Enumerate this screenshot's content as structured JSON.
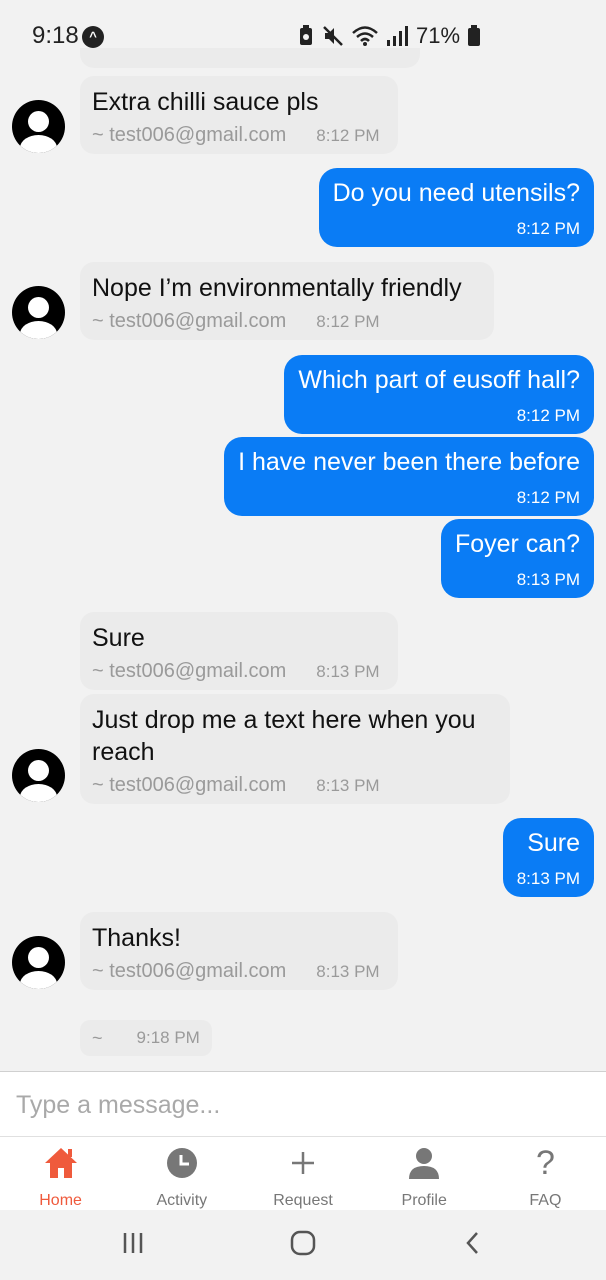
{
  "status_bar": {
    "time": "9:18",
    "battery": "71%"
  },
  "messages": [
    {
      "kind": "in",
      "text": "Extra chilli sauce pls",
      "sender": "~ test006@gmail.com",
      "time": "8:12 PM"
    },
    {
      "kind": "out",
      "text": "Do you need utensils?",
      "time": "8:12 PM"
    },
    {
      "kind": "in",
      "text": "Nope I’m environmentally friendly",
      "sender": "~ test006@gmail.com",
      "time": "8:12 PM"
    },
    {
      "kind": "out",
      "text": "Which part of eusoff hall?",
      "time": "8:12 PM"
    },
    {
      "kind": "out",
      "text": "I have never been there before",
      "time": "8:12 PM"
    },
    {
      "kind": "out",
      "text": "Foyer can?",
      "time": "8:13 PM"
    },
    {
      "kind": "in",
      "text": "Sure",
      "sender": "~ test006@gmail.com",
      "time": "8:13 PM"
    },
    {
      "kind": "in",
      "text": "Just drop me a text here when you reach",
      "sender": "~ test006@gmail.com",
      "time": "8:13 PM"
    },
    {
      "kind": "out",
      "text": "Sure",
      "time": "8:13 PM"
    },
    {
      "kind": "in",
      "text": "Thanks!",
      "sender": "~ test006@gmail.com",
      "time": "8:13 PM"
    },
    {
      "kind": "in",
      "text": "",
      "sender": "~",
      "time": "9:18 PM"
    }
  ],
  "composer": {
    "placeholder": "Type a message..."
  },
  "nav": {
    "home": "Home",
    "activity": "Activity",
    "request": "Request",
    "profile": "Profile",
    "faq": "FAQ",
    "active_color": "#ef5a3c",
    "inactive_color": "#777777"
  },
  "colors": {
    "outgoing_bubble": "#0a7cf5",
    "incoming_bubble": "#ebebeb",
    "background": "#f2f2f2"
  }
}
